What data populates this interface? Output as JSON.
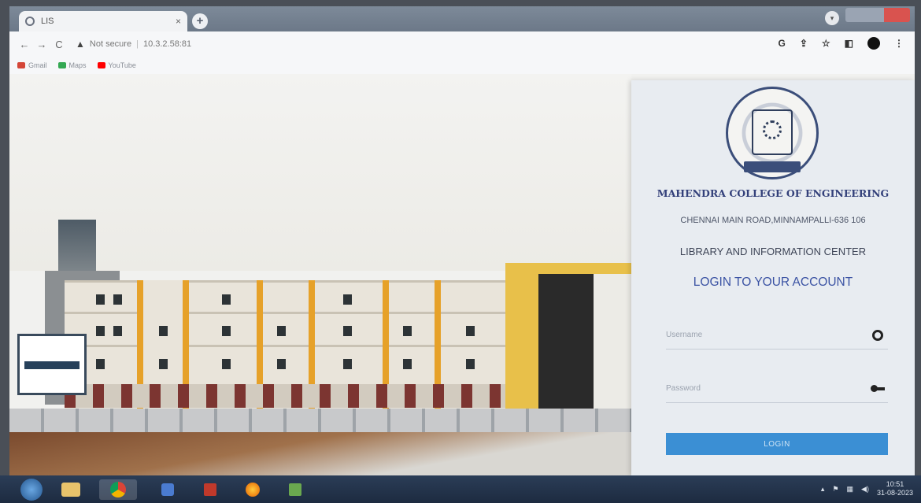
{
  "browser": {
    "tab_title": "LIS",
    "tab_close": "×",
    "new_tab": "+",
    "back": "←",
    "forward": "→",
    "reload": "C",
    "security_label": "Not secure",
    "url": "10.3.2.58:81",
    "bookmarks": [
      {
        "label": "Gmail",
        "color": "#d44638"
      },
      {
        "label": "Maps",
        "color": "#34a853"
      },
      {
        "label": "YouTube",
        "color": "#ff0000"
      }
    ],
    "toolbar_icons": [
      "google-icon",
      "share-icon",
      "star-icon",
      "sidebar-icon",
      "profile-avatar",
      "menu-icon"
    ]
  },
  "login": {
    "college_name": "MAHENDRA COLLEGE OF ENGINEERING",
    "address": "CHENNAI MAIN ROAD,MINNAMPALLI-636 106",
    "center_name": "LIBRARY AND INFORMATION CENTER",
    "title": "LOGIN TO YOUR ACCOUNT",
    "username_placeholder": "Username",
    "password_placeholder": "Password",
    "button_label": "LOGIN"
  },
  "taskbar": {
    "clock_time": "10:51",
    "clock_date": "31-08-2023"
  },
  "colors": {
    "accent": "#3b8fd4",
    "title_blue": "#3a52a3",
    "college_navy": "#33407a"
  }
}
